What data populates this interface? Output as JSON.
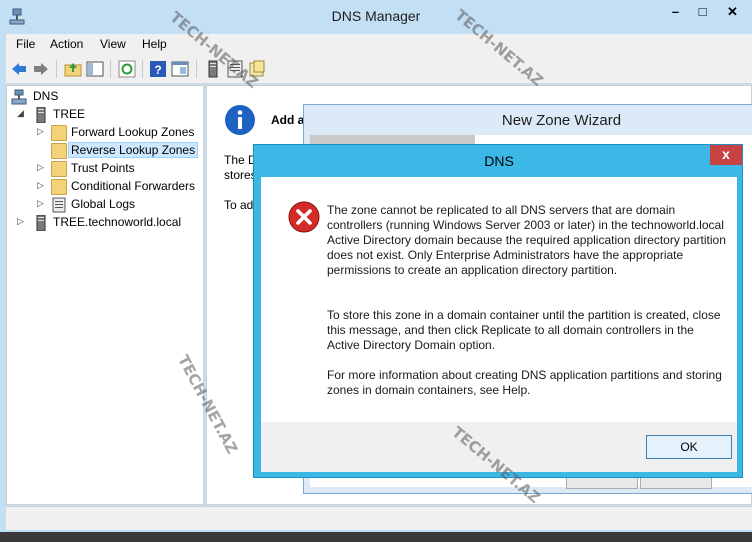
{
  "window": {
    "title": "DNS Manager"
  },
  "menu": [
    "File",
    "Action",
    "View",
    "Help"
  ],
  "tree": {
    "root": "DNS",
    "server1": "TREE",
    "children": [
      "Forward Lookup Zones",
      "Reverse Lookup Zones",
      "Trust Points",
      "Conditional Forwarders",
      "Global Logs"
    ],
    "server2": "TREE.technoworld.local"
  },
  "right_pane": {
    "line1": "Add a",
    "line2": "The D",
    "line3": "stores",
    "line4": "To ad"
  },
  "wizard": {
    "title": "New Zone Wizard"
  },
  "dialog": {
    "title": "DNS",
    "close": "x",
    "message1": "The zone cannot be replicated to all DNS servers that are domain controllers (running Windows Server 2003 or later) in the technoworld.local Active Directory domain because the required application directory partition does not exist. Only Enterprise Administrators have the appropriate permissions to create an application directory partition.",
    "message2": "To store this zone in a domain container until the partition is created, close this message, and then click Replicate to all domain controllers in the Active Directory Domain option.",
    "message3": "For more information about creating DNS application partitions and storing zones in domain containers, see Help.",
    "ok": "OK"
  },
  "watermark": "TECH-NET.AZ",
  "colors": {
    "accent": "#3cb8e6",
    "error": "#d42a2a",
    "info": "#1e63c4"
  }
}
